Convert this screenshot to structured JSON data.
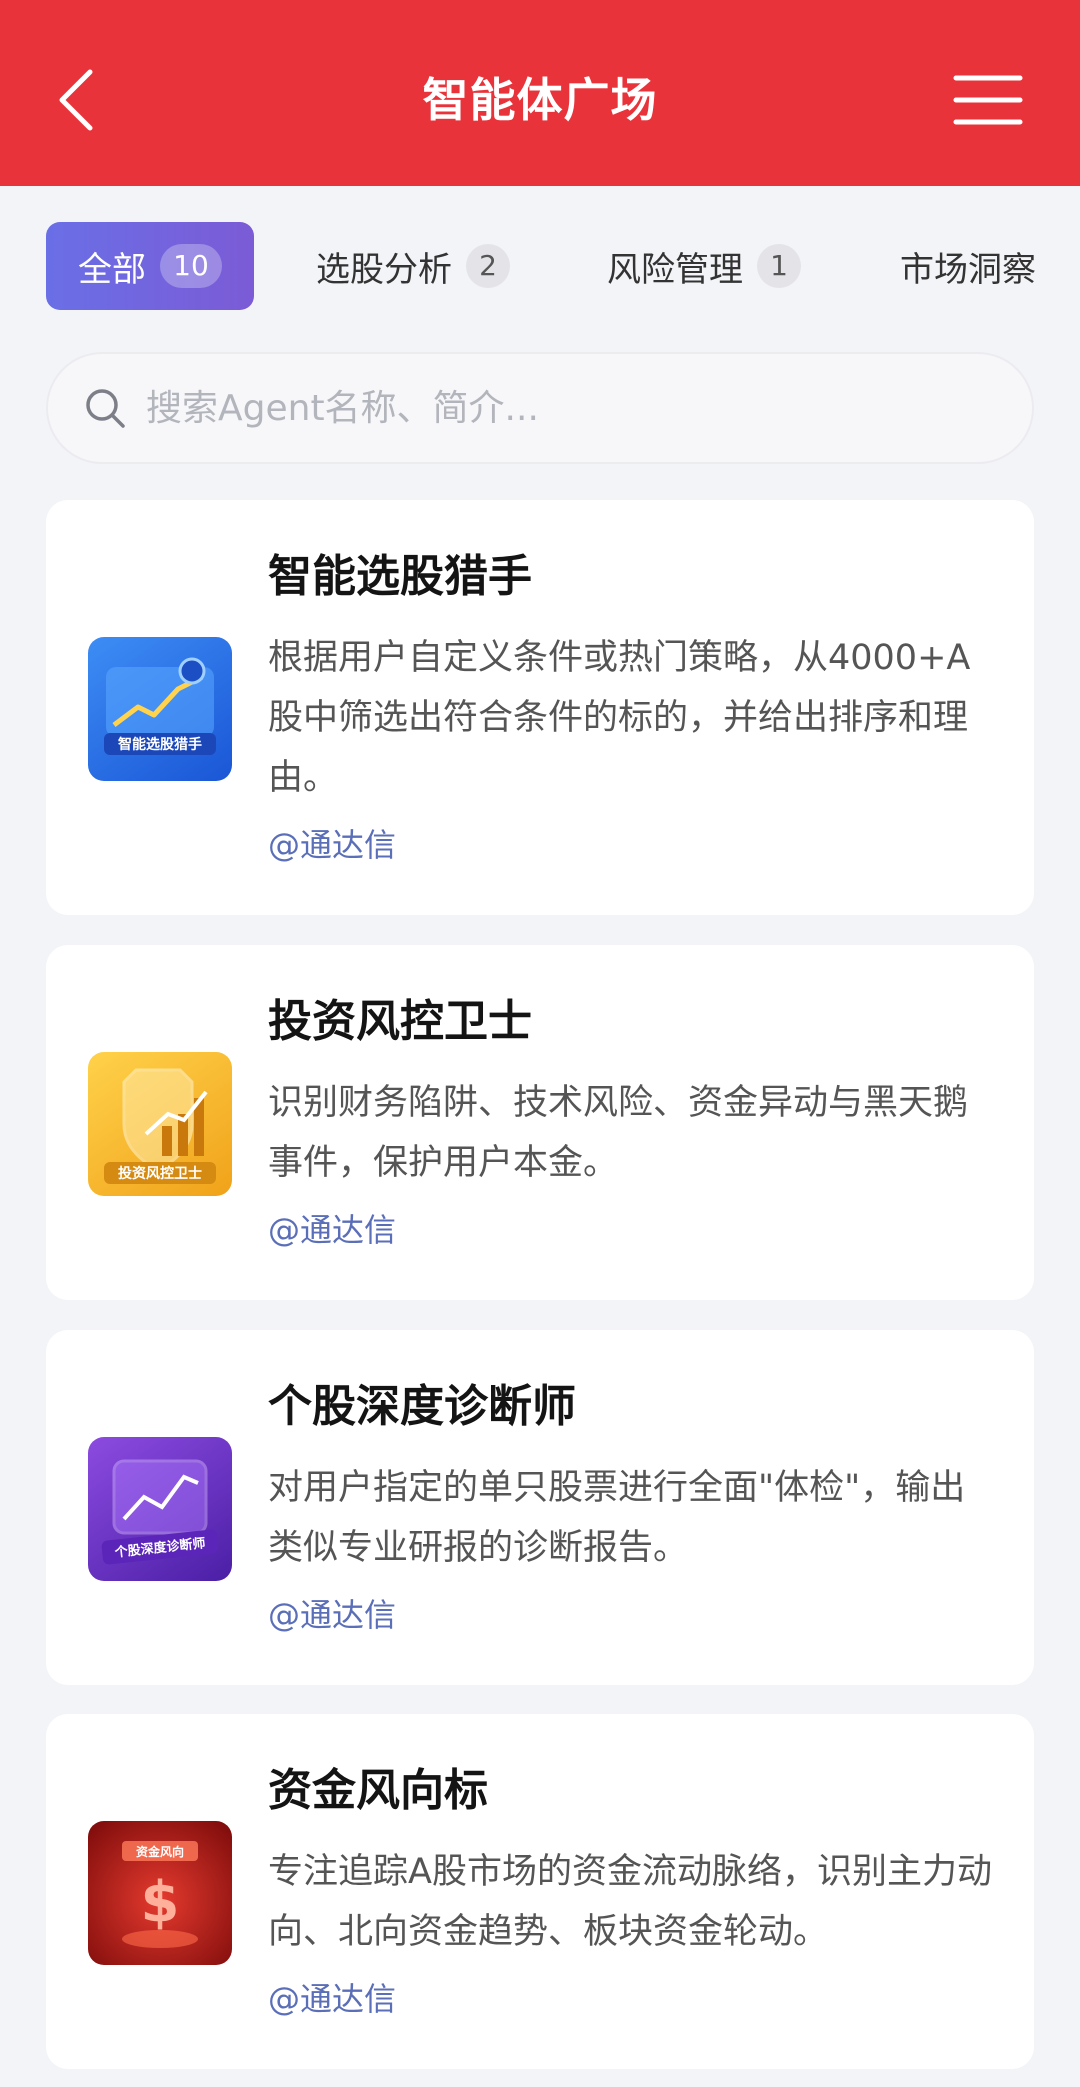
{
  "header": {
    "title": "智能体广场"
  },
  "tabs": [
    {
      "label": "全部",
      "count": "10",
      "active": true
    },
    {
      "label": "选股分析",
      "count": "2",
      "active": false
    },
    {
      "label": "风险管理",
      "count": "1",
      "active": false
    },
    {
      "label": "市场洞察",
      "count": "",
      "active": false
    }
  ],
  "search": {
    "placeholder": "搜索Agent名称、简介..."
  },
  "agents": [
    {
      "title": "智能选股猎手",
      "description": "根据用户自定义条件或热门策略，从4000+A股中筛选出符合条件的标的，并给出排序和理由。",
      "author": "@通达信",
      "icon_text": "智能选股猎手",
      "icon": "stock-picker-icon"
    },
    {
      "title": "投资风控卫士",
      "description": "识别财务陷阱、技术风险、资金异动与黑天鹅事件，保护用户本金。",
      "author": "@通达信",
      "icon_text": "投资风控卫士",
      "icon": "risk-shield-icon"
    },
    {
      "title": "个股深度诊断师",
      "description": "对用户指定的单只股票进行全面\"体检\"，输出类似专业研报的诊断报告。",
      "author": "@通达信",
      "icon_text": "个股深度诊断师",
      "icon": "stock-diagnosis-icon"
    },
    {
      "title": "资金风向标",
      "description": "专注追踪A股市场的资金流动脉络，识别主力动向、北向资金趋势、板块资金轮动。",
      "author": "@通达信",
      "icon_text": "资金风向",
      "icon": "fund-flow-icon"
    }
  ],
  "colors": {
    "header_bg": "#e8333a",
    "active_tab_start": "#6a6fe6",
    "active_tab_end": "#7b5bd6",
    "author_link": "#5b6fb8",
    "page_bg": "#f3f4f8"
  }
}
